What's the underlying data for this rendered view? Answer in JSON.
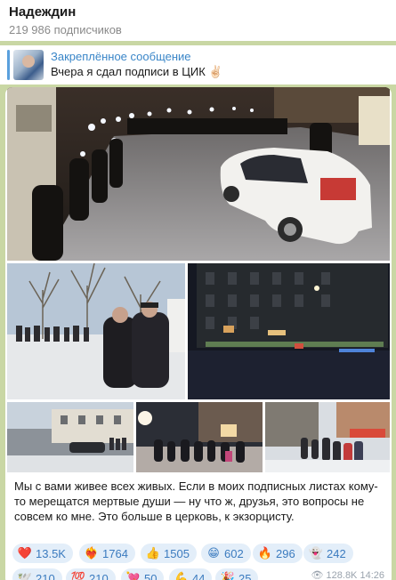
{
  "header": {
    "channel_name": "Надеждин",
    "subscribers": "219 986 подписчиков"
  },
  "pinned": {
    "title": "Закреплённое сообщение",
    "text": "Вчера я сдал подписи в ЦИК ✌🏻"
  },
  "post": {
    "caption": "Мы с вами живее всех живых. Если в моих подписных листах кому-то мерещатся мертвые души — ну что ж, друзья, это вопросы не совсем ко мне. Это больше в церковь, к экзорцисту.",
    "reactions": [
      {
        "icon": "heart-icon",
        "glyph": "❤️",
        "count": "13.5K"
      },
      {
        "icon": "heart-on-fire-icon",
        "glyph": "❤️‍🔥",
        "count": "1764"
      },
      {
        "icon": "thumbs-up-icon",
        "glyph": "👍",
        "count": "1505"
      },
      {
        "icon": "grinning-face-icon",
        "glyph": "😁",
        "count": "602"
      },
      {
        "icon": "fire-icon",
        "glyph": "🔥",
        "count": "296"
      },
      {
        "icon": "ghost-icon",
        "glyph": "👻",
        "count": "242"
      },
      {
        "icon": "dove-icon",
        "glyph": "🕊️",
        "count": "210"
      },
      {
        "icon": "hundred-points-icon",
        "glyph": "💯",
        "count": "210"
      },
      {
        "icon": "heart-with-arrow-icon",
        "glyph": "💘",
        "count": "50"
      },
      {
        "icon": "flexed-biceps-icon",
        "glyph": "💪",
        "count": "44"
      },
      {
        "icon": "party-popper-icon",
        "glyph": "🎉",
        "count": "25"
      }
    ],
    "views": "128.8K",
    "time": "14:26"
  }
}
